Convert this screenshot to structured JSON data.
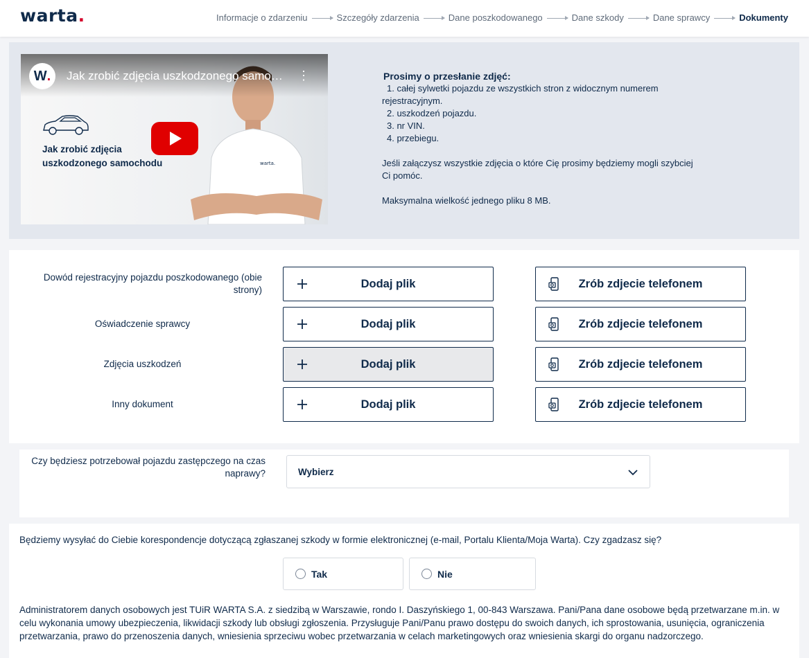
{
  "header": {
    "logo": "warta",
    "logo_dot": ".",
    "steps": [
      {
        "label": "Informacje o zdarzeniu"
      },
      {
        "label": "Szczegóły zdarzenia"
      },
      {
        "label": "Dane poszkodowanego"
      },
      {
        "label": "Dane szkody"
      },
      {
        "label": "Dane sprawcy"
      },
      {
        "label": "Dokumenty"
      }
    ],
    "active_step": "Dokumenty"
  },
  "video": {
    "channel_logo": "W",
    "channel_logo_dot": ".",
    "title": "Jak zrobić zdjęcia uszkodzonego samochodu",
    "caption_line1": "Jak zrobić zdjęcia",
    "caption_line2": "uszkodzonego samochodu",
    "play_icon": "play-icon",
    "menu_icon": "more-vert-icon"
  },
  "info": {
    "heading": "Prosimy o przesłanie zdjęć:",
    "items": [
      "1. całej sylwetki pojazdu ze wszystkich stron z widocznym numerem",
      "2. uszkodzeń pojazdu.",
      "3. nr VIN.",
      "4. przebiegu."
    ],
    "item1_wrap": "rejestracyjnym.",
    "note_line1": "Jeśli załączysz wszystkie zdjęcia o które Cię prosimy będziemy mogli szybciej",
    "note_line2": "Ci pomóc.",
    "max_size": "Maksymalna wielkość jednego pliku 8 MB."
  },
  "uploads": {
    "add_label": "Dodaj plik",
    "photo_label": "Zrób zdjecie telefonem",
    "rows": [
      {
        "label": "Dowód rejestracyjny pojazdu poszkodowanego (obie strony)"
      },
      {
        "label": "Oświadczenie sprawcy"
      },
      {
        "label": "Zdjęcia uszkodzeń"
      },
      {
        "label": "Inny dokument"
      }
    ]
  },
  "replacement": {
    "label": "Czy będziesz potrzebował pojazdu zastępczego na czas naprawy?",
    "select_value": "Wybierz"
  },
  "correspondence": {
    "question": "Będziemy wysyłać do Ciebie korespondencje dotyczącą zgłaszanej szkody w formie elektronicznej (e-mail, Portalu Klienta/Moja Warta). Czy zgadzasz się?",
    "option_yes": "Tak",
    "option_no": "Nie",
    "gdpr": "Administratorem danych osobowych jest TUiR WARTA S.A. z siedzibą w Warszawie, rondo I. Daszyńskiego 1, 00-843 Warszawa. Pani/Pana dane osobowe będą przetwarzane m.in. w celu wykonania umowy ubezpieczenia, likwidacji szkody lub obsługi zgłoszenia. Przysługuje Pani/Panu prawo dostępu do swoich danych, ich sprostowania, usunięcia, ograniczenia przetwarzania, prawo do przenoszenia danych, wniesienia sprzeciwu wobec przetwarzania w celach marketingowych oraz wniesienia skargi do organu nadzorczego."
  },
  "colors": {
    "navy": "#0f2a4a",
    "brand_red": "#d4002a",
    "panel_bg": "#e3e7ee",
    "youtube_red": "#e00000"
  }
}
